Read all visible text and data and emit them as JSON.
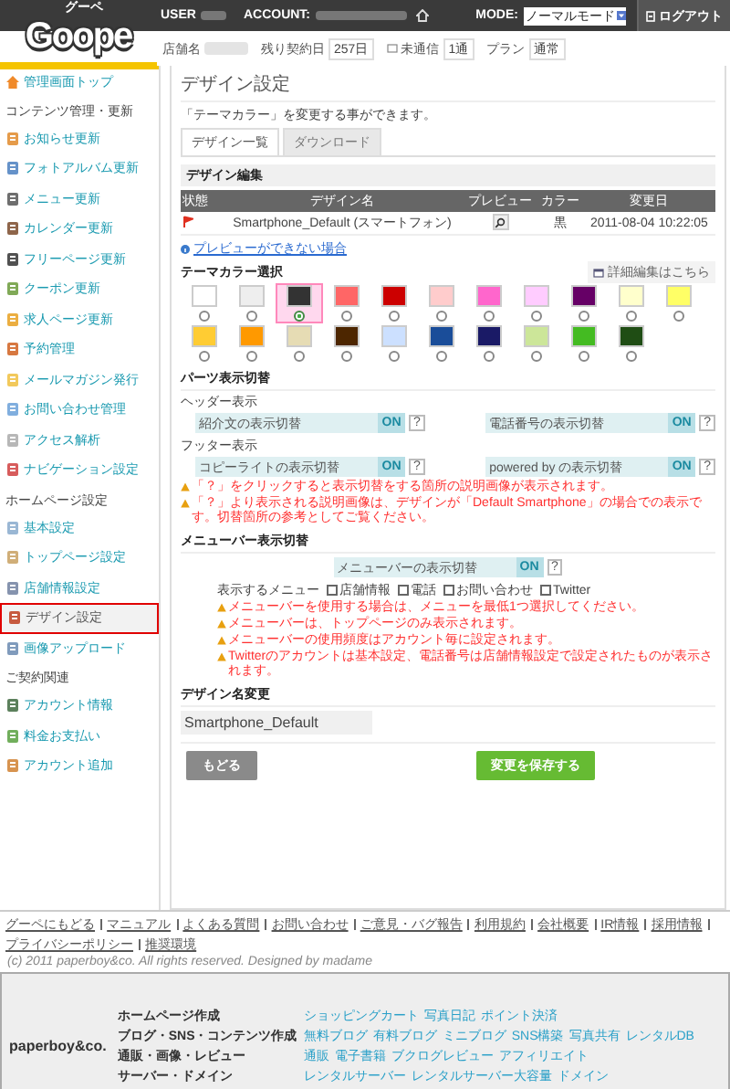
{
  "header": {
    "logo_caption": "グーペ",
    "logo": "Goope",
    "user_label": "USER",
    "account_label": "ACCOUNT:",
    "mode_label": "MODE:",
    "mode_value": "ノーマルモード",
    "logout": "ログアウト"
  },
  "info_bar": [
    {
      "kind": "text",
      "label": "店舗名"
    },
    {
      "kind": "text",
      "label": "残り契約日",
      "value": "257日"
    },
    {
      "kind": "mail",
      "label": "未通信",
      "value": "1通"
    },
    {
      "kind": "text",
      "label": "プラン",
      "value": "通常"
    }
  ],
  "sidebar": {
    "top": "管理画面トップ",
    "sections": [
      {
        "title": "コンテンツ管理・更新",
        "items": [
          {
            "label": "お知らせ更新",
            "selected": false
          },
          {
            "label": "フォトアルバム更新",
            "selected": false
          },
          {
            "label": "メニュー更新",
            "selected": false
          },
          {
            "label": "カレンダー更新",
            "selected": false
          },
          {
            "label": "フリーページ更新",
            "selected": false
          },
          {
            "label": "クーポン更新",
            "selected": false
          },
          {
            "label": "求人ページ更新",
            "selected": false
          },
          {
            "label": "予約管理",
            "selected": false
          },
          {
            "label": "メールマガジン発行",
            "selected": false
          },
          {
            "label": "お問い合わせ管理",
            "selected": false
          },
          {
            "label": "アクセス解析",
            "selected": false
          },
          {
            "label": "ナビゲーション設定",
            "selected": false
          }
        ]
      },
      {
        "title": "ホームページ設定",
        "items": [
          {
            "label": "基本設定",
            "selected": false
          },
          {
            "label": "トップページ設定",
            "selected": false
          },
          {
            "label": "店舗情報設定",
            "selected": false
          },
          {
            "label": "デザイン設定",
            "selected": true
          },
          {
            "label": "画像アップロード",
            "selected": false
          }
        ]
      },
      {
        "title": "ご契約関連",
        "items": [
          {
            "label": "アカウント情報",
            "selected": false
          },
          {
            "label": "料金お支払い",
            "selected": false
          },
          {
            "label": "アカウント追加",
            "selected": false
          }
        ]
      }
    ]
  },
  "page": {
    "title": "デザイン設定",
    "description": "「テーマカラー」を変更する事ができます。"
  },
  "tabs": [
    {
      "label": "デザイン一覧",
      "selected": true
    },
    {
      "label": "ダウンロード",
      "selected": false
    }
  ],
  "design_edit": {
    "title": "デザイン編集",
    "columns": [
      "状態",
      "デザイン名",
      "プレビュー",
      "カラー",
      "変更日"
    ],
    "rows": [
      {
        "name": "Smartphone_Default (スマートフォン)",
        "theme_color": "黒",
        "date": "2011-08-04 10:22:05"
      }
    ],
    "help_link": "プレビューができない場合"
  },
  "theme": {
    "title": "テーマカラー選択",
    "detail_button": "詳細編集はこちら",
    "rows": [
      [
        {
          "color": "#ffffff",
          "selected": false
        },
        {
          "color": "#eeeeee",
          "selected": false
        },
        {
          "color": "#333333",
          "selected": true
        },
        {
          "color": "#ff6666",
          "selected": false
        },
        {
          "color": "#cc0000",
          "selected": false
        },
        {
          "color": "#ffcccc",
          "selected": false
        },
        {
          "color": "#ff66cc",
          "selected": false
        },
        {
          "color": "#ffccff",
          "selected": false
        },
        {
          "color": "#660066",
          "selected": false
        },
        {
          "color": "#ffffcc",
          "selected": false
        },
        {
          "color": "#ffff66",
          "selected": false
        }
      ],
      [
        {
          "color": "#ffcc33",
          "selected": false
        },
        {
          "color": "#ff9900",
          "selected": false
        },
        {
          "color": "#e6dcb4",
          "selected": false
        },
        {
          "color": "#4d2600",
          "selected": false
        },
        {
          "color": "#cce0ff",
          "selected": false
        },
        {
          "color": "#1a4d99",
          "selected": false
        },
        {
          "color": "#1a1a66",
          "selected": false
        },
        {
          "color": "#cce699",
          "selected": false
        },
        {
          "color": "#44bb22",
          "selected": false
        },
        {
          "color": "#1f4d14",
          "selected": false
        }
      ]
    ]
  },
  "parts": {
    "title": "パーツ表示切替",
    "groups": [
      {
        "title": "ヘッダー表示",
        "toggles": [
          {
            "label": "紹介文の表示切替",
            "state": "ON",
            "on": true,
            "help": "?"
          },
          {
            "label": "電話番号の表示切替",
            "state": "ON",
            "on": true,
            "help": "?"
          }
        ]
      },
      {
        "title": "フッター表示",
        "toggles": [
          {
            "label": "コピーライトの表示切替",
            "state": "ON",
            "on": true,
            "help": "?"
          },
          {
            "label": "powered by の表示切替",
            "state": "ON",
            "on": true,
            "help": "?"
          }
        ]
      }
    ],
    "warnings": [
      "「？」をクリックすると表示切替をする箇所の説明画像が表示されます。",
      "「？」より表示される説明画像は、デザインが「Default Smartphone」の場合での表示です。切替箇所の参考としてご覧ください。"
    ]
  },
  "menubar": {
    "title": "メニューバー表示切替",
    "toggle": {
      "label": "メニューバーの表示切替",
      "state": "ON",
      "on": true,
      "help": "?"
    },
    "menu_label": "表示するメニュー",
    "options": [
      {
        "label": "店舗情報",
        "checked": false
      },
      {
        "label": "電話",
        "checked": false
      },
      {
        "label": "お問い合わせ",
        "checked": false
      },
      {
        "label": "Twitter",
        "checked": false
      }
    ],
    "warnings": [
      "メニューバーを使用する場合は、メニューを最低1つ選択してください。",
      "メニューバーは、トップページのみ表示されます。",
      "メニューバーの使用頻度はアカウント毎に設定されます。",
      "Twitterのアカウントは基本設定、電話番号は店舗情報設定で設定されたものが表示されます。"
    ]
  },
  "rename": {
    "title": "デザイン名変更",
    "value": "Smartphone_Default"
  },
  "buttons": {
    "back": "もどる",
    "save": "変更を保存する"
  },
  "footer": {
    "links": [
      "グーペにもどる",
      "マニュアル",
      "よくある質問",
      "お問い合わせ",
      "ご意見・バグ報告",
      "利用規約",
      "会社概要",
      "IR情報",
      "採用情報",
      "プライバシーポリシー",
      "推奨環境"
    ],
    "copyright": "(c) 2011 paperboy&co. All rights reserved. Designed by madame",
    "company": "paperboy&co.",
    "categories": [
      {
        "label": "ホームページ作成",
        "links": [
          "ショッピングカート",
          "写真日記",
          "ポイント決済"
        ]
      },
      {
        "label": "ブログ・SNS・コンテンツ作成",
        "links": [
          "無料ブログ",
          "有料ブログ",
          "ミニブログ",
          "SNS構築",
          "写真共有",
          "レンタルDB"
        ]
      },
      {
        "label": "通販・画像・レビュー",
        "links": [
          "通販",
          "電子書籍",
          "ブクログレビュー",
          "アフィリエイト"
        ]
      },
      {
        "label": "サーバー・ドメイン",
        "links": [
          "レンタルサーバー",
          "レンタルサーバー大容量",
          "ドメイン"
        ]
      }
    ]
  }
}
